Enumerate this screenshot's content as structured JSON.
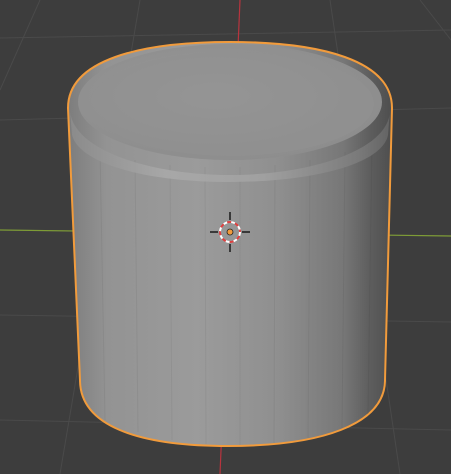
{
  "viewport": {
    "background": "#3d3d3d",
    "grid_color": "#4a4a4a",
    "x_axis_color": "#7e9c36",
    "y_axis_color": "#b8343e"
  },
  "object": {
    "type": "cylinder",
    "selected": true,
    "selection_outline_color": "#f19b3c",
    "base_color": "#8e8e8e",
    "top_color": "#959595",
    "bevel_color": "#a6a6a6"
  },
  "cursor_3d": {
    "icon": "3d-cursor-icon",
    "ring_color_a": "#e04040",
    "ring_color_b": "#ffffff"
  },
  "origin": {
    "icon": "origin-dot-icon",
    "color": "#f19b3c"
  }
}
